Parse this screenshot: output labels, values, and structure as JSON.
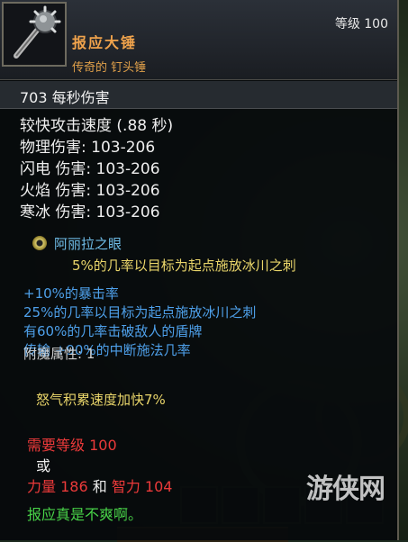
{
  "item": {
    "name": "报应大锤",
    "type": "传奇的 钉头锤",
    "level_label": "等级 100",
    "dps": "703  每秒伤害"
  },
  "stats": [
    "较快攻击速度 (.88 秒)",
    "物理伤害: 103-206",
    "闪电 伤害: 103-206",
    "火焰 伤害: 103-206",
    "寒冰 伤害: 103-206"
  ],
  "socket": {
    "gem_name": "阿丽拉之眼",
    "effect": "5%的几率以目标为起点施放冰川之刺"
  },
  "affixes": [
    "+10%的暴击率",
    "25%的几率以目标为起点施放冰川之刺",
    "有60%的几率击破敌人的盾牌",
    "传输 +90%的中断施法几率"
  ],
  "enchant": {
    "label": "附魔属性: 1",
    "effect": "怒气积累速度加快7%"
  },
  "requirements": {
    "level": "需要等级 100",
    "or": "或",
    "strength": "力量 186",
    "and": "和",
    "intellect": "智力 104"
  },
  "flavor": "报应真是不爽啊。",
  "watermark": "游侠网",
  "colors": {
    "item_name": "#f0a34c",
    "magic_affix": "#4ea0ea",
    "gem_effect": "#e9d56a",
    "requirement": "#ec3a3a",
    "flavor": "#48d248"
  }
}
